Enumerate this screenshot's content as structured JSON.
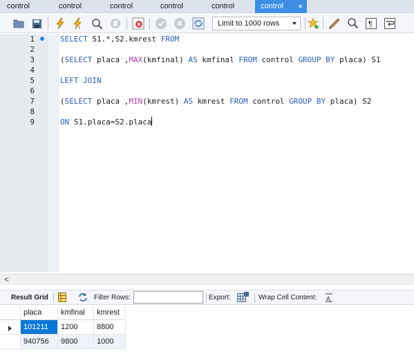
{
  "tabs": [
    {
      "label": "control",
      "active": false
    },
    {
      "label": "control",
      "active": false
    },
    {
      "label": "control",
      "active": false
    },
    {
      "label": "control",
      "active": false
    },
    {
      "label": "control",
      "active": false
    },
    {
      "label": "control",
      "active": true
    }
  ],
  "tab_close_glyph": "×",
  "toolbar": {
    "limit_value": "Limit to 1000 rows",
    "icons": [
      "open-folder-icon",
      "save-icon",
      "execute-icon",
      "execute-current-icon",
      "explain-icon",
      "stop-icon",
      "toggle-error-icon",
      "commit-icon",
      "rollback-icon",
      "autocommit-icon",
      "add-snippet-icon",
      "beautify-icon",
      "find-icon",
      "invisible-chars-icon",
      "wrap-icon"
    ]
  },
  "editor": {
    "line_numbers": [
      "1",
      "2",
      "3",
      "4",
      "5",
      "6",
      "7",
      "8",
      "9"
    ],
    "lines": {
      "l1": {
        "kw1": "SELECT",
        "t1": " S1.*,S2.kmrest ",
        "kw2": "FROM"
      },
      "l3": {
        "t1": "(",
        "kw1": "SELECT",
        "t2": " placa ,",
        "fn1": "MAX",
        "t3": "(kmfinal) ",
        "kw2": "AS",
        "t4": " kmfinal ",
        "kw3": "FROM",
        "t5": " control ",
        "kw4": "GROUP BY",
        "t6": " placa) S1"
      },
      "l5": {
        "kw1": "LEFT JOIN"
      },
      "l7": {
        "t1": "(",
        "kw1": "SELECT",
        "t2": " placa ,",
        "fn1": "MIN",
        "t3": "(kmrest) ",
        "kw2": "AS",
        "t4": " kmrest ",
        "kw3": "FROM",
        "t5": " control ",
        "kw4": "GROUP BY",
        "t6": " placa) S2"
      },
      "l9": {
        "kw1": "ON",
        "t1": " S1.placa=S2.placa"
      }
    }
  },
  "scroll_left_glyph": "<",
  "result_toolbar": {
    "result_grid_label": "Result Grid",
    "filter_rows_label": "Filter Rows:",
    "export_label": "Export:",
    "wrap_label": "Wrap Cell Content:"
  },
  "grid": {
    "columns": [
      "placa",
      "kmfinal",
      "kmrest"
    ],
    "rows": [
      [
        "101211",
        "1200",
        "8800"
      ],
      [
        "940756",
        "9800",
        "1000"
      ]
    ]
  },
  "colors": {
    "keyword": "#2e5cb8",
    "function": "#b23ab0",
    "active_tab": "#3d8ee5",
    "selection": "#0a78d7"
  }
}
